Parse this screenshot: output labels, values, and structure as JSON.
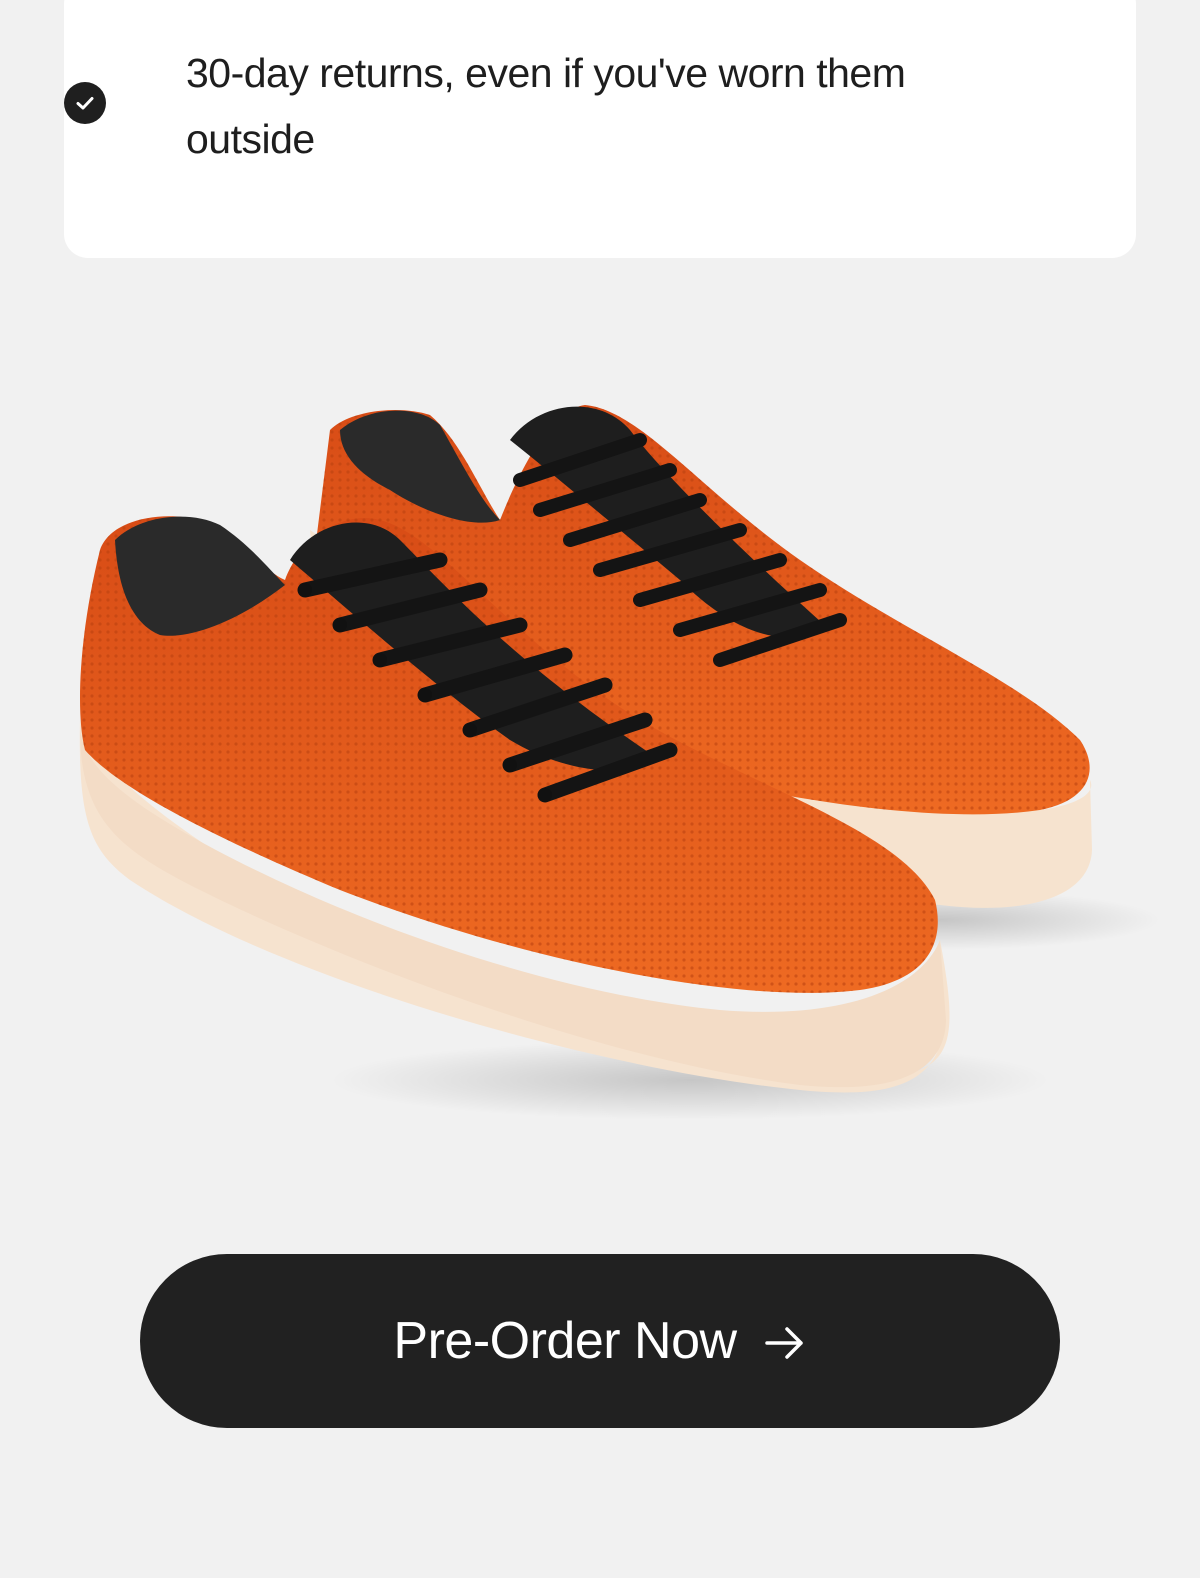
{
  "benefits": {
    "items": [
      {
        "icon": "check-circle-icon",
        "text": "30-day returns, even if you've worn them outside"
      }
    ]
  },
  "product": {
    "image_icon": "sneaker-pair-image",
    "colors": {
      "upper": "#e3571c",
      "laces": "#1a1a1a",
      "sole": "#f6e3cf"
    }
  },
  "cta": {
    "label": "Pre-Order Now",
    "icon": "arrow-right-icon",
    "background": "#212121"
  },
  "theme": {
    "page_background": "#f1f1f1",
    "card_background": "#ffffff"
  }
}
